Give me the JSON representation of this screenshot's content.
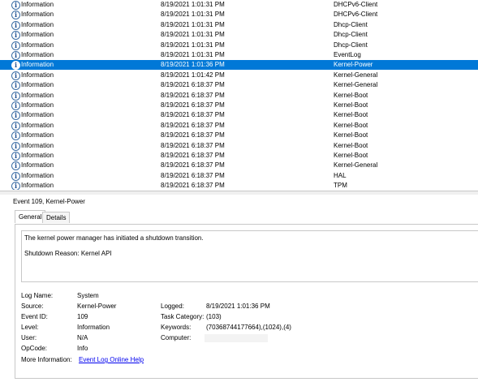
{
  "events": [
    {
      "level": "Information",
      "date": "8/19/2021 1:01:31 PM",
      "source": "DHCPv6-Client",
      "selected": false
    },
    {
      "level": "Information",
      "date": "8/19/2021 1:01:31 PM",
      "source": "DHCPv6-Client",
      "selected": false
    },
    {
      "level": "Information",
      "date": "8/19/2021 1:01:31 PM",
      "source": "Dhcp-Client",
      "selected": false
    },
    {
      "level": "Information",
      "date": "8/19/2021 1:01:31 PM",
      "source": "Dhcp-Client",
      "selected": false
    },
    {
      "level": "Information",
      "date": "8/19/2021 1:01:31 PM",
      "source": "Dhcp-Client",
      "selected": false
    },
    {
      "level": "Information",
      "date": "8/19/2021 1:01:31 PM",
      "source": "EventLog",
      "selected": false
    },
    {
      "level": "Information",
      "date": "8/19/2021 1:01:36 PM",
      "source": "Kernel-Power",
      "selected": true
    },
    {
      "level": "Information",
      "date": "8/19/2021 1:01:42 PM",
      "source": "Kernel-General",
      "selected": false
    },
    {
      "level": "Information",
      "date": "8/19/2021 6:18:37 PM",
      "source": "Kernel-General",
      "selected": false
    },
    {
      "level": "Information",
      "date": "8/19/2021 6:18:37 PM",
      "source": "Kernel-Boot",
      "selected": false
    },
    {
      "level": "Information",
      "date": "8/19/2021 6:18:37 PM",
      "source": "Kernel-Boot",
      "selected": false
    },
    {
      "level": "Information",
      "date": "8/19/2021 6:18:37 PM",
      "source": "Kernel-Boot",
      "selected": false
    },
    {
      "level": "Information",
      "date": "8/19/2021 6:18:37 PM",
      "source": "Kernel-Boot",
      "selected": false
    },
    {
      "level": "Information",
      "date": "8/19/2021 6:18:37 PM",
      "source": "Kernel-Boot",
      "selected": false
    },
    {
      "level": "Information",
      "date": "8/19/2021 6:18:37 PM",
      "source": "Kernel-Boot",
      "selected": false
    },
    {
      "level": "Information",
      "date": "8/19/2021 6:18:37 PM",
      "source": "Kernel-Boot",
      "selected": false
    },
    {
      "level": "Information",
      "date": "8/19/2021 6:18:37 PM",
      "source": "Kernel-General",
      "selected": false
    },
    {
      "level": "Information",
      "date": "8/19/2021 6:18:37 PM",
      "source": "HAL",
      "selected": false
    },
    {
      "level": "Information",
      "date": "8/19/2021 6:18:37 PM",
      "source": "TPM",
      "selected": false
    }
  ],
  "row_icon": "information-icon",
  "selection_color": "#0078d7",
  "detail": {
    "title": "Event 109, Kernel-Power",
    "tabs": {
      "general": "General",
      "details": "Details",
      "active": "General"
    },
    "message_line1": "The kernel power manager has initiated a shutdown transition.",
    "message_line2": "Shutdown Reason: Kernel API",
    "labels": {
      "log_name": "Log Name:",
      "source": "Source:",
      "event_id": "Event ID:",
      "level": "Level:",
      "user": "User:",
      "opcode": "OpCode:",
      "more_info": "More Information:",
      "logged": "Logged:",
      "task_category": "Task Category:",
      "keywords": "Keywords:",
      "computer": "Computer:"
    },
    "values": {
      "log_name": "System",
      "source": "Kernel-Power",
      "event_id": "109",
      "level": "Information",
      "user": "N/A",
      "opcode": "Info",
      "more_info_link": "Event Log Online Help",
      "logged": "8/19/2021 1:01:36 PM",
      "task_category": "(103)",
      "keywords": "(70368744177664),(1024),(4)",
      "computer": ""
    }
  }
}
